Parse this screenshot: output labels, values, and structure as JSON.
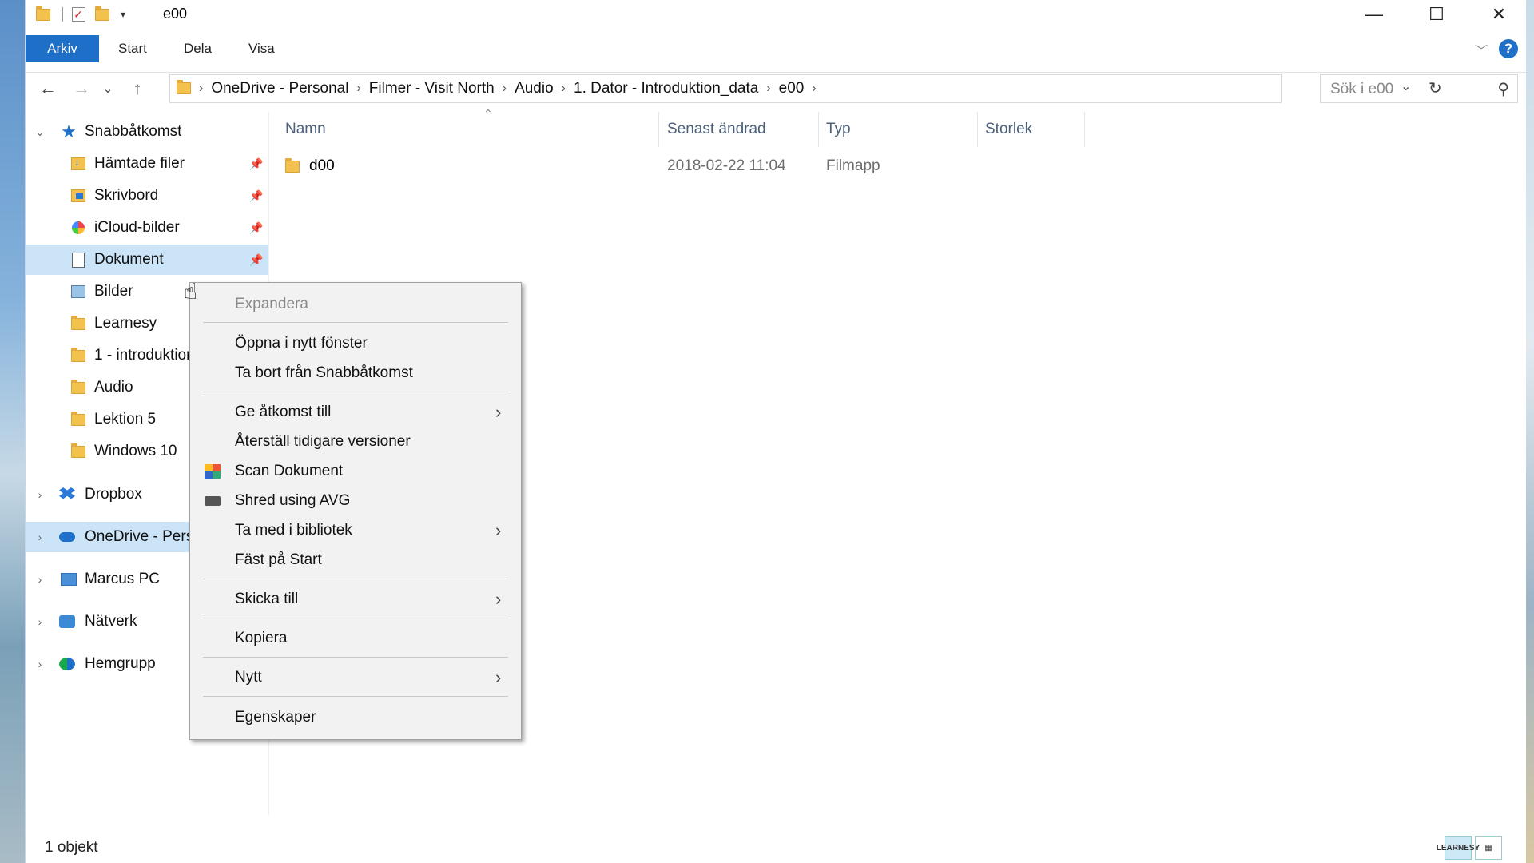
{
  "titlebar": {
    "title": "e00",
    "quick_access_dropdown": "▾"
  },
  "window_controls": {
    "minimize": "—",
    "maximize": "☐",
    "close": "✕"
  },
  "ribbon": {
    "tabs": [
      {
        "label": "Arkiv"
      },
      {
        "label": "Start"
      },
      {
        "label": "Dela"
      },
      {
        "label": "Visa"
      }
    ],
    "help": "?"
  },
  "address": {
    "crumbs": [
      "OneDrive - Personal",
      "Filmer - Visit North",
      "Audio",
      "1. Dator - Introduktion_data",
      "e00"
    ]
  },
  "search": {
    "placeholder": "Sök i e00"
  },
  "navpane": {
    "quick_access": "Snabbåtkomst",
    "items": [
      {
        "label": "Hämtade filer",
        "pinned": true
      },
      {
        "label": "Skrivbord",
        "pinned": true
      },
      {
        "label": "iCloud-bilder",
        "pinned": true
      },
      {
        "label": "Dokument",
        "pinned": true
      },
      {
        "label": "Bilder"
      },
      {
        "label": "Learnesy"
      },
      {
        "label": "1 - introduktion"
      },
      {
        "label": "Audio"
      },
      {
        "label": "Lektion 5"
      },
      {
        "label": "Windows 10"
      }
    ],
    "roots": [
      {
        "label": "Dropbox"
      },
      {
        "label": "OneDrive - Personal"
      },
      {
        "label": "Marcus PC"
      },
      {
        "label": "Nätverk"
      },
      {
        "label": "Hemgrupp"
      }
    ]
  },
  "columns": {
    "name": "Namn",
    "modified": "Senast ändrad",
    "type": "Typ",
    "size": "Storlek"
  },
  "files": [
    {
      "name": "d00",
      "modified": "2018-02-22 11:04",
      "type": "Filmapp"
    }
  ],
  "status": {
    "text": "1 objekt"
  },
  "context_menu": {
    "items": [
      {
        "label": "Expandera",
        "disabled": true
      },
      {
        "label": "Öppna i nytt fönster"
      },
      {
        "label": "Ta bort från Snabbåtkomst"
      },
      {
        "label": "Ge åtkomst till",
        "submenu": true
      },
      {
        "label": "Återställ tidigare versioner"
      },
      {
        "label": "Scan Dokument",
        "icon": "avg-scan-icon"
      },
      {
        "label": "Shred using AVG",
        "icon": "avg-shred-icon"
      },
      {
        "label": "Ta med i bibliotek",
        "submenu": true
      },
      {
        "label": "Fäst på Start"
      },
      {
        "label": "Skicka till",
        "submenu": true
      },
      {
        "label": "Kopiera"
      },
      {
        "label": "Nytt",
        "submenu": true
      },
      {
        "label": "Egenskaper"
      }
    ]
  },
  "watermark": "LEARNESY",
  "colors": {
    "accent": "#1e6fc8",
    "selection": "#cce4f7",
    "menu_bg": "#f2f2f2"
  }
}
